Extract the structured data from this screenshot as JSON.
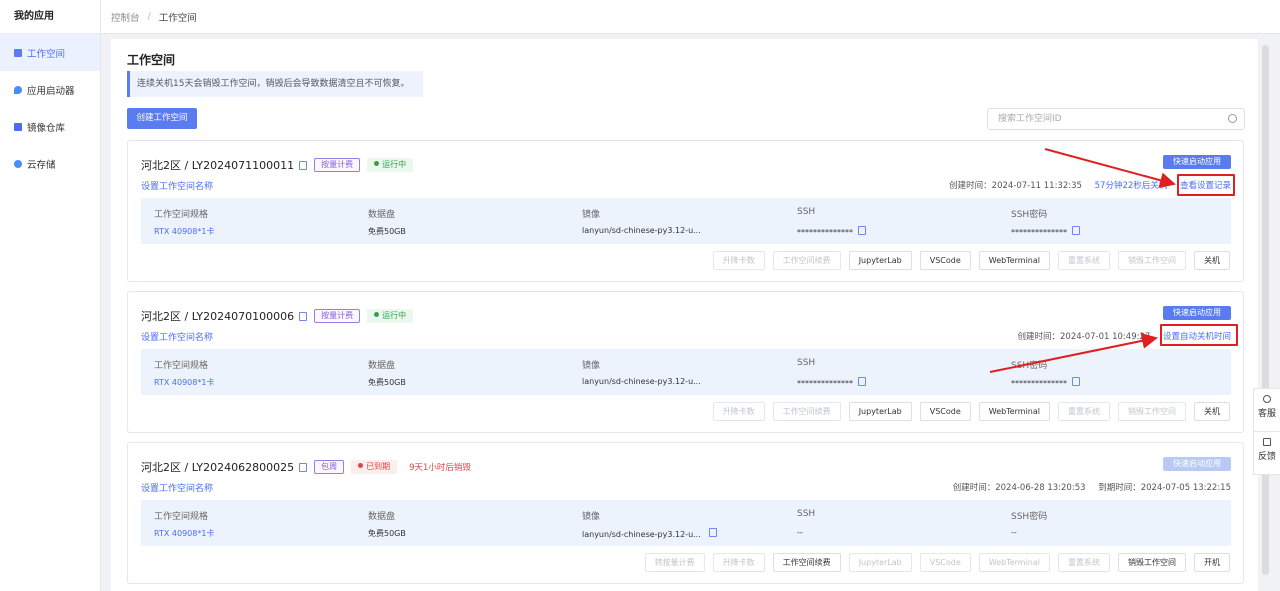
{
  "sidebar": {
    "title": "我的应用",
    "items": [
      {
        "label": "工作空间",
        "icon": "grid-icon",
        "active": true
      },
      {
        "label": "应用启动器",
        "icon": "drop-icon",
        "active": false
      },
      {
        "label": "镜像仓库",
        "icon": "box-icon",
        "active": false
      },
      {
        "label": "云存储",
        "icon": "cloud-icon",
        "active": false
      }
    ]
  },
  "breadcrumb": {
    "root": "控制台",
    "sep": "/",
    "current": "工作空间"
  },
  "page": {
    "title": "工作空间",
    "notice": "连续关机15天会销毁工作空间，销毁后会导致数据清空且不可恢复。",
    "create_label": "创建工作空间",
    "search_placeholder": "搜索工作空间ID"
  },
  "spec_headers": [
    "工作空间规格",
    "数据盘",
    "镜像",
    "SSH",
    "SSH密码"
  ],
  "cards": [
    {
      "title": "河北2区 / LY2024071100011",
      "billing": "按量计费",
      "status": "运行中",
      "quick": "快速启动应用",
      "setname": "设置工作空间名称",
      "created": "创建时间：2024-07-11 11:32:35",
      "extra": "57分钟22秒后关机",
      "link": "查看设置记录",
      "spec": [
        "RTX 40908*1卡",
        "免费50GB",
        "lanyun/sd-chinese-py3.12-u...",
        "**************",
        "**************"
      ],
      "actions": [
        {
          "label": "升降卡数",
          "enabled": false
        },
        {
          "label": "工作空间续费",
          "enabled": false
        },
        {
          "label": "JupyterLab",
          "enabled": true
        },
        {
          "label": "VSCode",
          "enabled": true
        },
        {
          "label": "WebTerminal",
          "enabled": true
        },
        {
          "label": "重置系统",
          "enabled": false
        },
        {
          "label": "销毁工作空间",
          "enabled": false
        },
        {
          "label": "关机",
          "enabled": true
        }
      ]
    },
    {
      "title": "河北2区 / LY2024070100006",
      "billing": "按量计费",
      "status": "运行中",
      "quick": "快速启动应用",
      "setname": "设置工作空间名称",
      "created": "创建时间：2024-07-01 10:49:27",
      "link": "设置自动关机时间",
      "spec": [
        "RTX 40908*1卡",
        "免费50GB",
        "lanyun/sd-chinese-py3.12-u...",
        "**************",
        "**************"
      ],
      "actions": [
        {
          "label": "升降卡数",
          "enabled": false
        },
        {
          "label": "工作空间续费",
          "enabled": false
        },
        {
          "label": "JupyterLab",
          "enabled": true
        },
        {
          "label": "VSCode",
          "enabled": true
        },
        {
          "label": "WebTerminal",
          "enabled": true
        },
        {
          "label": "重置系统",
          "enabled": false
        },
        {
          "label": "销毁工作空间",
          "enabled": false
        },
        {
          "label": "关机",
          "enabled": true
        }
      ]
    },
    {
      "title": "河北2区 / LY2024062800025",
      "billing": "包周",
      "status": "已到期",
      "warning": "9天1小时后销毁",
      "quick": "快速启动应用",
      "setname": "设置工作空间名称",
      "created": "创建时间：2024-06-28 13:20:53",
      "expires": "到期时间：2024-07-05 13:22:15",
      "spec": [
        "RTX 40908*1卡",
        "免费50GB",
        "lanyun/sd-chinese-py3.12-u...",
        "--",
        "--"
      ],
      "actions": [
        {
          "label": "转按量计费",
          "enabled": false
        },
        {
          "label": "升降卡数",
          "enabled": false
        },
        {
          "label": "工作空间续费",
          "enabled": true
        },
        {
          "label": "JupyterLab",
          "enabled": false
        },
        {
          "label": "VSCode",
          "enabled": false
        },
        {
          "label": "WebTerminal",
          "enabled": false
        },
        {
          "label": "重置系统",
          "enabled": false
        },
        {
          "label": "销毁工作空间",
          "enabled": true
        },
        {
          "label": "开机",
          "enabled": true
        }
      ]
    }
  ],
  "float": {
    "service": "客服",
    "feedback": "反馈"
  },
  "colors": {
    "accent": "#5b7bf0",
    "running": "#35a04a",
    "expired": "#e04545",
    "annotation": "#e02020"
  }
}
